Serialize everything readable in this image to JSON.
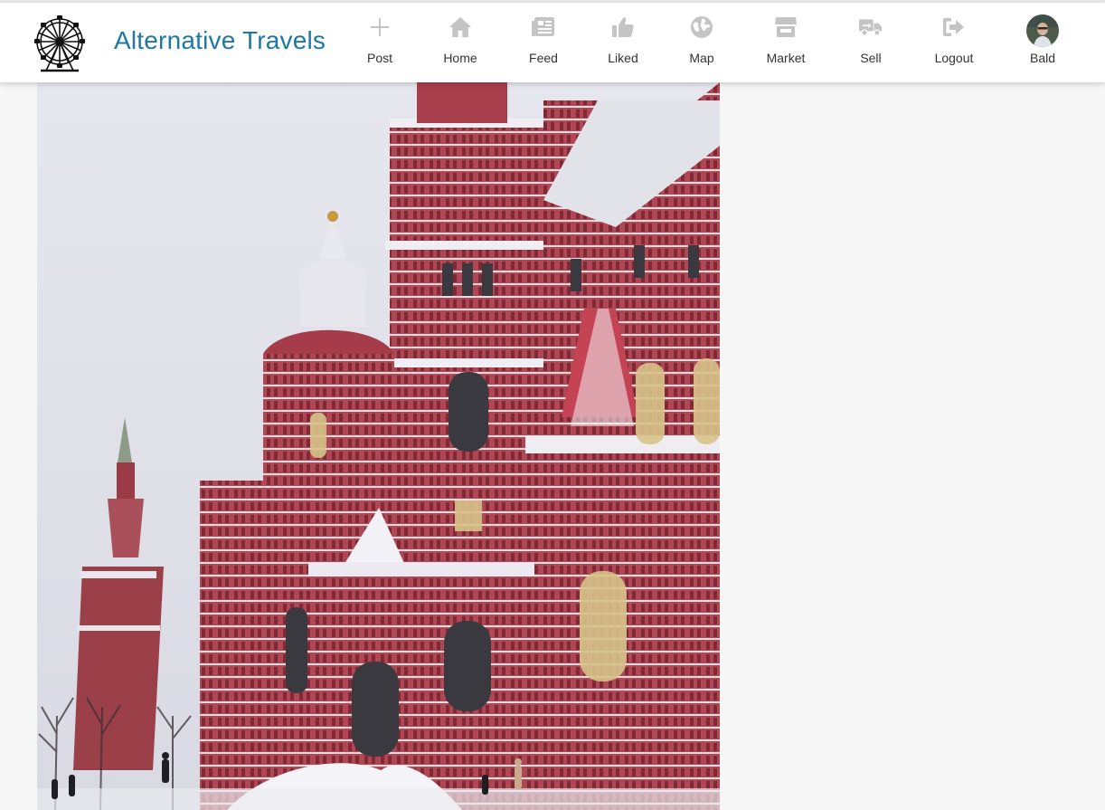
{
  "app": {
    "title": "Alternative Travels"
  },
  "nav": {
    "items": [
      {
        "key": "post",
        "label": "Post",
        "icon": "plus-icon"
      },
      {
        "key": "home",
        "label": "Home",
        "icon": "home-icon"
      },
      {
        "key": "feed",
        "label": "Feed",
        "icon": "feed-icon"
      },
      {
        "key": "liked",
        "label": "Liked",
        "icon": "thumbs-up-icon"
      },
      {
        "key": "map",
        "label": "Map",
        "icon": "globe-icon"
      },
      {
        "key": "market",
        "label": "Market",
        "icon": "store-icon"
      },
      {
        "key": "sell",
        "label": "Sell",
        "icon": "truck-icon"
      },
      {
        "key": "logout",
        "label": "Logout",
        "icon": "logout-icon"
      }
    ],
    "user": {
      "label": "Bald",
      "icon": "avatar"
    }
  },
  "colors": {
    "brand": "#1f77a6",
    "nav_icon": "#c4c4c4",
    "background": "#f6f6f6"
  },
  "post": {
    "image": "photo of red-brick historical museum building in snow"
  }
}
